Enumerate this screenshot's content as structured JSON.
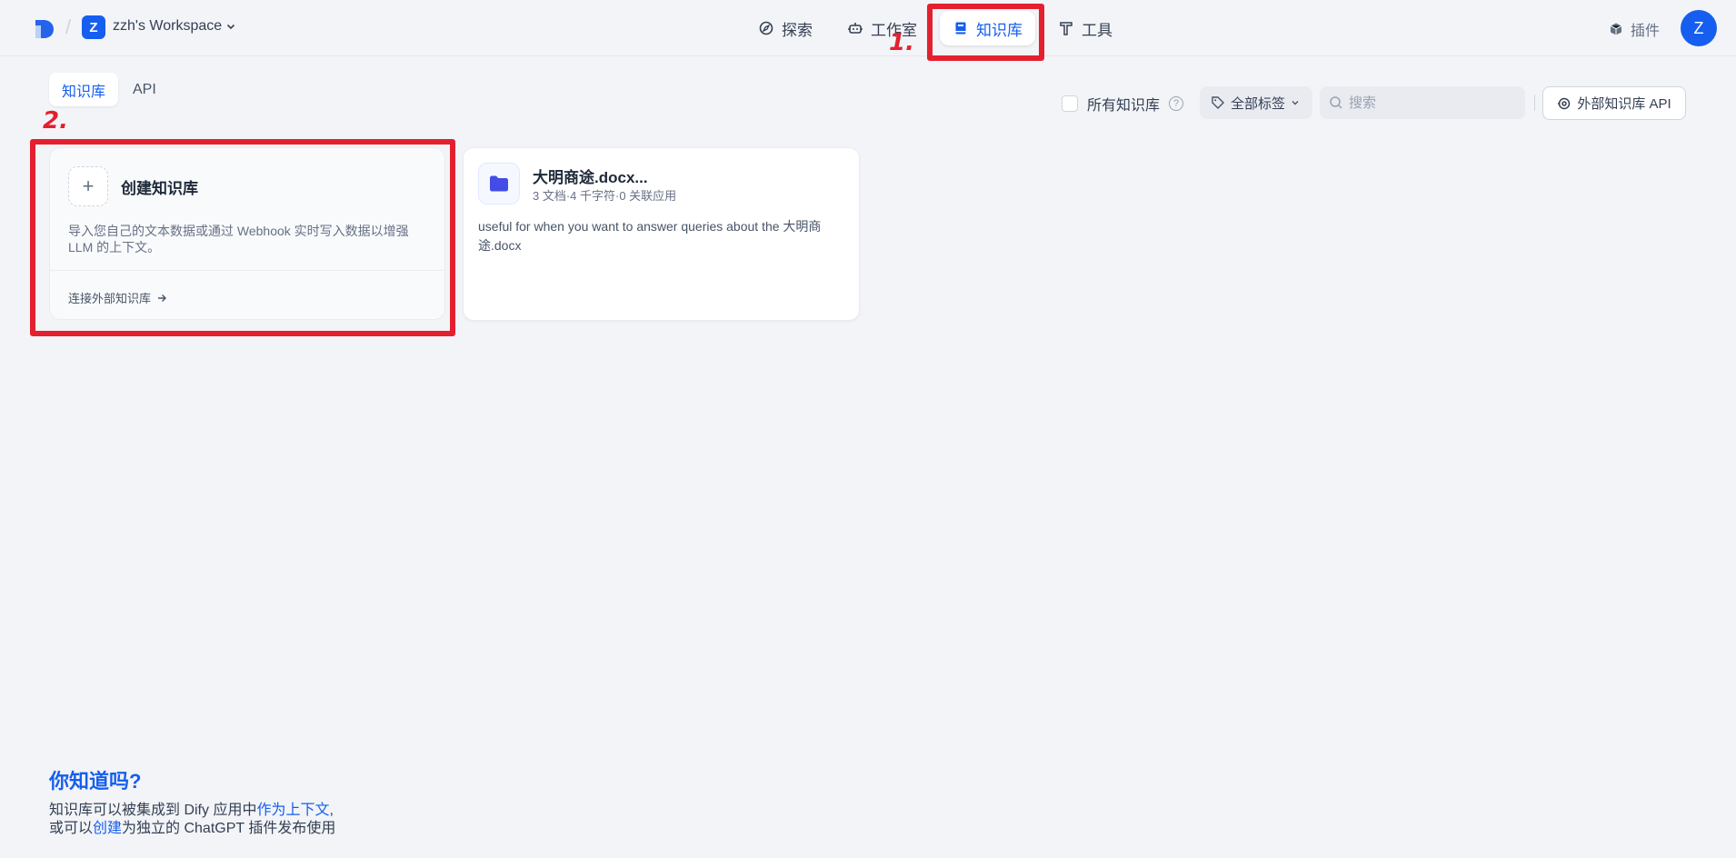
{
  "header": {
    "workspace_initial": "Z",
    "workspace_name": "zzh's Workspace",
    "nav": {
      "explore": "探索",
      "studio": "工作室",
      "knowledge": "知识库",
      "tools": "工具"
    },
    "plugins": "插件",
    "user_initial": "Z"
  },
  "annotations": {
    "step1": "1.",
    "step2": "2."
  },
  "subtabs": {
    "knowledge": "知识库",
    "api": "API"
  },
  "filters": {
    "all_knowledge": "所有知识库",
    "help": "?",
    "tags": "全部标签",
    "search_placeholder": "搜索",
    "external_api": "外部知识库 API"
  },
  "create_card": {
    "plus": "+",
    "title": "创建知识库",
    "description": "导入您自己的文本数据或通过 Webhook 实时写入数据以增强 LLM 的上下文。",
    "connect_link": "连接外部知识库"
  },
  "datasets": [
    {
      "title": "大明商途.docx...",
      "meta": "3 文档·4 千字符·0 关联应用",
      "description": "useful for when you want to answer queries about the 大明商途.docx"
    }
  ],
  "tip": {
    "title": "你知道吗?",
    "line1_prefix": "知识库可以被集成到 Dify 应用中",
    "line1_link": "作为上下文",
    "line1_suffix": ",",
    "line2_prefix": "或可以",
    "line2_link": "创建",
    "line2_suffix": "为独立的 ChatGPT 插件发布使用"
  },
  "colors": {
    "accent": "#155eef",
    "annotation_red": "#e4202f",
    "background": "#f3f4f7"
  }
}
